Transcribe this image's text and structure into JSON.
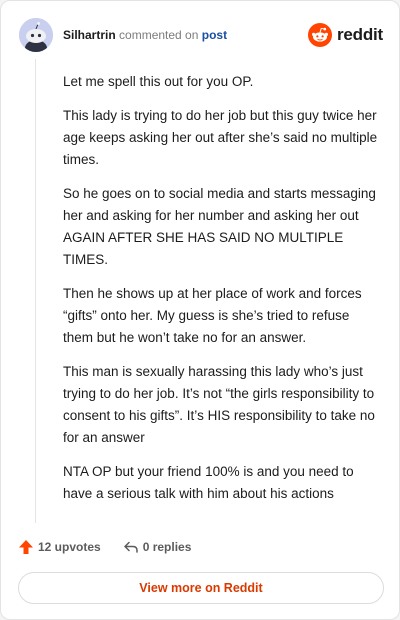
{
  "header": {
    "author": "Silhartrin",
    "action_text": "commented on",
    "post_link": "post",
    "logo_text": "reddit"
  },
  "comment": {
    "paragraphs": [
      "Let me spell this out for you OP.",
      "This lady is trying to do her job but this guy twice her age keeps asking her out after she’s said no multiple times.",
      "So he goes on to social media and starts messaging her and asking for her number and asking her out AGAIN AFTER SHE HAS SAID NO MULTIPLE TIMES.",
      "Then he shows up at her place of work and forces “gifts” onto her. My guess is she’s tried to refuse them but he won’t take no for an answer.",
      "This man is sexually harassing this lady who’s just trying to do her job. It’s not “the girls responsibility to consent to his gifts”. It’s HIS responsibility to take no for an answer",
      "NTA OP but your friend 100% is and you need to have a serious talk with him about his actions"
    ]
  },
  "actions": {
    "upvotes": "12 upvotes",
    "replies": "0 replies"
  },
  "footer": {
    "view_more": "View more on Reddit"
  },
  "colors": {
    "brand": "#ff4500",
    "link": "#1a4fa3",
    "view_more": "#d93a00"
  },
  "icons": {
    "avatar": "snoo-avatar",
    "logo": "reddit-alien-icon",
    "upvote": "upvote-arrow-icon",
    "reply": "reply-arrow-icon"
  }
}
